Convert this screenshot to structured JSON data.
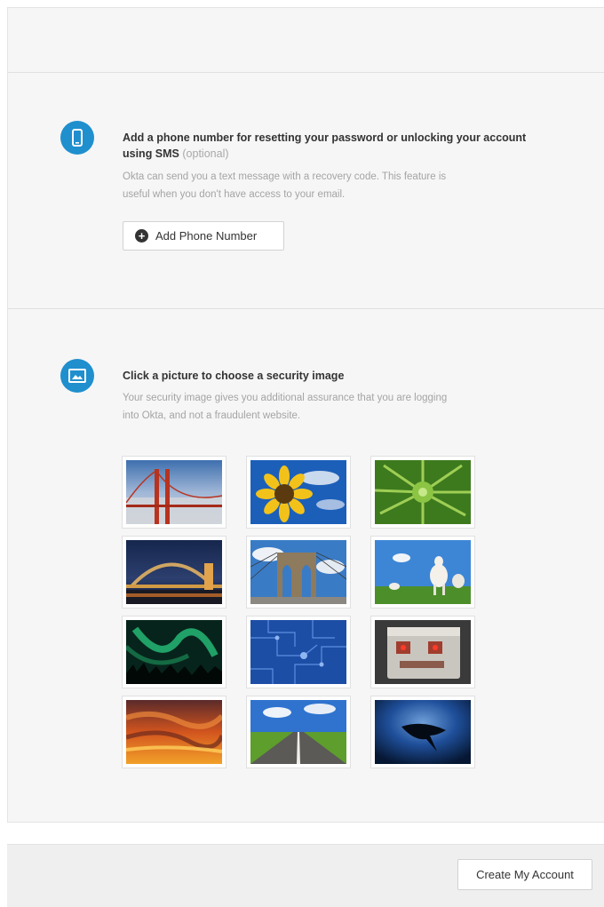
{
  "phone_section": {
    "heading": "Add a phone number for resetting your password or unlocking your account using SMS",
    "optional": "(optional)",
    "description_line1": "Okta can send you a text message with a recovery code. This feature is",
    "description_line2": "useful when you don't have access to your email.",
    "button_label": "Add Phone Number",
    "icon": "phone-icon"
  },
  "security_image_section": {
    "heading": "Click a picture to choose a security image",
    "description_line1": "Your security image gives you additional assurance that you are logging",
    "description_line2": "into Okta, and not a fraudulent website.",
    "icon": "picture-icon",
    "images": [
      {
        "name": "golden-gate-bridge"
      },
      {
        "name": "sunflower"
      },
      {
        "name": "green-succulent"
      },
      {
        "name": "harbour-bridge-night"
      },
      {
        "name": "brooklyn-bridge"
      },
      {
        "name": "goats-in-field"
      },
      {
        "name": "northern-lights"
      },
      {
        "name": "blue-circuit-board"
      },
      {
        "name": "robot-toy"
      },
      {
        "name": "orange-sunset-clouds"
      },
      {
        "name": "road-through-fields"
      },
      {
        "name": "manta-ray"
      }
    ]
  },
  "footer": {
    "create_account_label": "Create My Account"
  },
  "colors": {
    "accent": "#1f8fce",
    "panel": "#f6f6f6",
    "footer": "#efefef"
  }
}
